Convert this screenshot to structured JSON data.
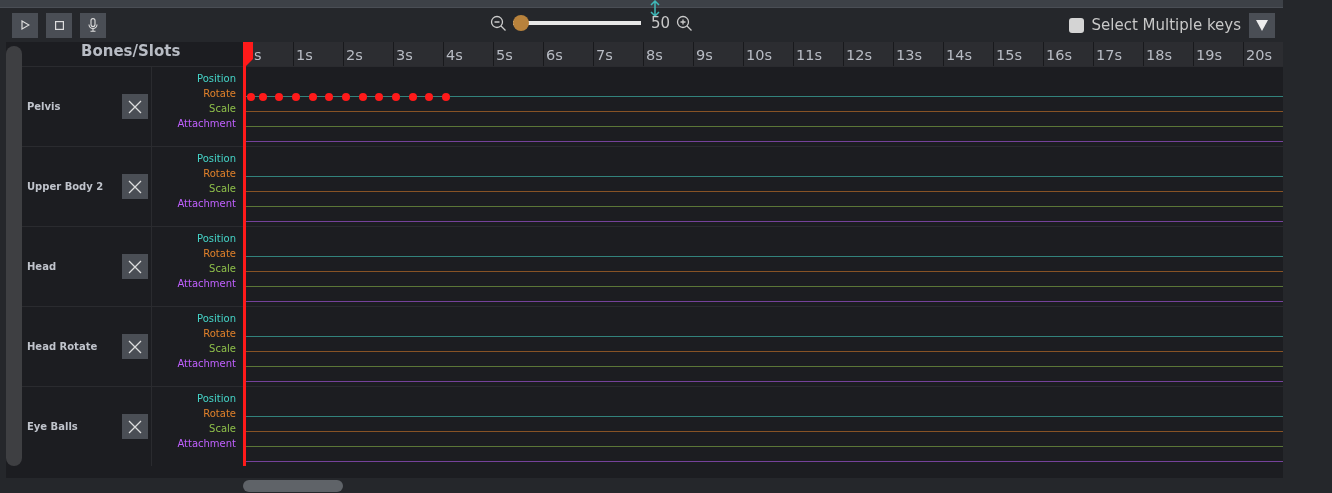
{
  "toolbar": {
    "buttons": [
      {
        "kind": "play"
      },
      {
        "kind": "stop"
      },
      {
        "kind": "record"
      }
    ],
    "zoom": {
      "level": 0.0,
      "value": "50"
    },
    "select_multiple": {
      "label": "Select Multiple keys",
      "checked": false
    }
  },
  "header": {
    "title": "Bones/Slots"
  },
  "ruler": {
    "ticks": [
      "s",
      "1s",
      "2s",
      "3s",
      "4s",
      "5s",
      "6s",
      "7s",
      "8s",
      "9s",
      "10s",
      "11s",
      "12s",
      "13s",
      "14s",
      "15s",
      "16s",
      "17s",
      "18s",
      "19s",
      "20s"
    ]
  },
  "bones": [
    {
      "name": "Pelvis",
      "tracks": [
        {
          "label": "Position",
          "color": "#45d6c9",
          "keyframes": [
            {
              "selected": false
            },
            {
              "selected": false
            },
            {
              "selected": false
            },
            {
              "selected": false
            },
            {
              "selected": false
            },
            {
              "selected": false
            },
            {
              "selected": false
            },
            {
              "selected": false
            },
            {
              "selected": false
            },
            {
              "selected": false
            },
            {
              "selected": false
            },
            {
              "selected": false
            },
            {
              "selected": false
            }
          ]
        },
        {
          "label": "Rotate",
          "color": "#e0802a"
        },
        {
          "label": "Scale",
          "color": "#8fc04a"
        },
        {
          "label": "Attachment",
          "color": "#c060ff"
        }
      ]
    },
    {
      "name": "Upper Body 2",
      "tracks": [
        {
          "label": "Position",
          "color": "#45d6c9"
        },
        {
          "label": "Rotate",
          "color": "#e0802a"
        },
        {
          "label": "Scale",
          "color": "#8fc04a"
        },
        {
          "label": "Attachment",
          "color": "#c060ff"
        }
      ]
    },
    {
      "name": "Head",
      "tracks": [
        {
          "label": "Position",
          "color": "#45d6c9"
        },
        {
          "label": "Rotate",
          "color": "#e0802a"
        },
        {
          "label": "Scale",
          "color": "#8fc04a"
        },
        {
          "label": "Attachment",
          "color": "#c060ff"
        }
      ]
    },
    {
      "name": "Head Rotate",
      "tracks": [
        {
          "label": "Position",
          "color": "#45d6c9"
        },
        {
          "label": "Rotate",
          "color": "#e0802a"
        },
        {
          "label": "Scale",
          "color": "#8fc04a"
        },
        {
          "label": "Attachment",
          "color": "#c060ff"
        }
      ]
    },
    {
      "name": "Eye Balls",
      "tracks": [
        {
          "label": "Position",
          "color": "#45d6c9"
        },
        {
          "label": "Rotate",
          "color": "#e0802a"
        },
        {
          "label": "Scale",
          "color": "#8fc04a"
        },
        {
          "label": "Attachment",
          "color": "#c060ff"
        }
      ]
    }
  ]
}
